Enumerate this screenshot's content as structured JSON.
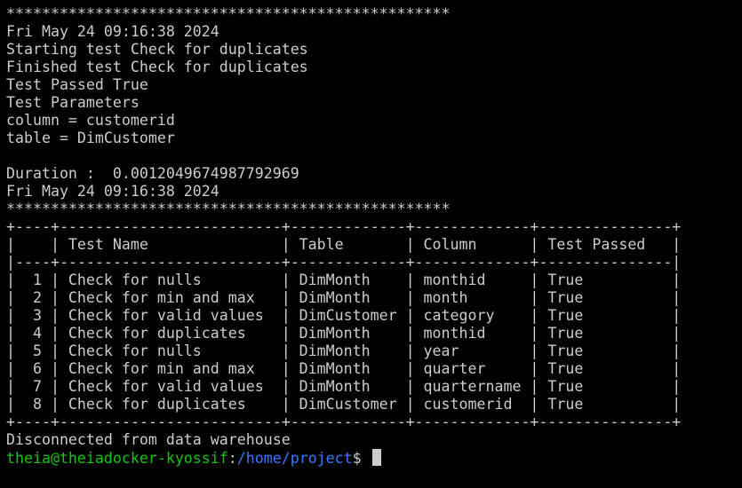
{
  "terminal": {
    "lines": [
      "**************************************************",
      "Fri May 24 09:16:38 2024",
      "Starting test Check for duplicates",
      "Finished test Check for duplicates",
      "Test Passed True",
      "Test Parameters",
      "column = customerid",
      "table = DimCustomer",
      "",
      "Duration :  0.0012049674987792969",
      "Fri May 24 09:16:38 2024",
      "**************************************************",
      "+----+-------------------------+-------------+-------------+---------------+",
      "|    | Test Name               | Table       | Column      | Test Passed   |",
      "|----+-------------------------+-------------+-------------+---------------|",
      "|  1 | Check for nulls         | DimMonth    | monthid     | True          |",
      "|  2 | Check for min and max   | DimMonth    | month       | True          |",
      "|  3 | Check for valid values  | DimCustomer | category    | True          |",
      "|  4 | Check for duplicates    | DimMonth    | monthid     | True          |",
      "|  5 | Check for nulls         | DimMonth    | year        | True          |",
      "|  6 | Check for min and max   | DimMonth    | quarter     | True          |",
      "|  7 | Check for valid values  | DimMonth    | quartername | True          |",
      "|  8 | Check for duplicates    | DimCustomer | customerid  | True          |",
      "+----+-------------------------+-------------+-------------+---------------+",
      "Disconnected from data warehouse"
    ],
    "prompt": {
      "user_host": "theia@theiadocker-kyossif",
      "separator": ":",
      "path": "/home/project",
      "symbol": "$ "
    },
    "colors": {
      "background": "#000000",
      "text": "#cccccc",
      "user_host": "#16c60c",
      "path": "#3b78ff"
    }
  }
}
